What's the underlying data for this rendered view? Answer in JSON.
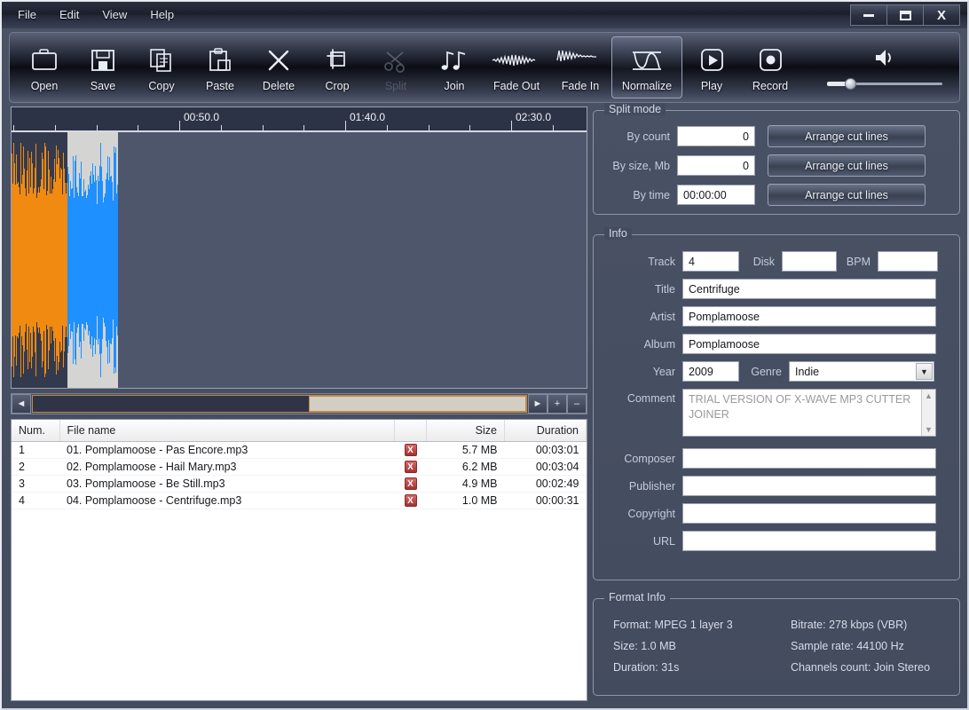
{
  "window": {
    "menus": [
      "File",
      "Edit",
      "View",
      "Help"
    ],
    "controls": {
      "minimize": "–",
      "maximize": "□",
      "close": "X"
    }
  },
  "toolbar": {
    "buttons": [
      {
        "label": "Open",
        "icon": "folder-open-icon",
        "state": "normal"
      },
      {
        "label": "Save",
        "icon": "floppy-disk-icon",
        "state": "normal"
      },
      {
        "label": "Copy",
        "icon": "copy-pages-icon",
        "state": "normal"
      },
      {
        "label": "Paste",
        "icon": "clipboard-icon",
        "state": "normal"
      },
      {
        "label": "Delete",
        "icon": "x-cross-icon",
        "state": "normal"
      },
      {
        "label": "Crop",
        "icon": "crop-icon",
        "state": "normal"
      },
      {
        "label": "Split",
        "icon": "scissors-icon",
        "state": "disabled"
      },
      {
        "label": "Join",
        "icon": "music-notes-icon",
        "state": "normal"
      },
      {
        "label": "Fade Out",
        "icon": "fade-out-wave-icon",
        "state": "normal"
      },
      {
        "label": "Fade In",
        "icon": "fade-in-wave-icon",
        "state": "normal"
      },
      {
        "label": "Normalize",
        "icon": "normalize-wave-icon",
        "state": "selected"
      },
      {
        "label": "Play",
        "icon": "play-icon",
        "state": "normal"
      },
      {
        "label": "Record",
        "icon": "record-icon",
        "state": "normal"
      }
    ],
    "volume": {
      "icon": "speaker-icon",
      "value": 17
    }
  },
  "waveform": {
    "ruler_labels": [
      "00:50.0",
      "01:40.0",
      "02:30.0"
    ],
    "colors": {
      "unselected_wave": "#f08a10",
      "selected_wave": "#1e90ff",
      "selection_bg": "#d4d4d2",
      "track_bg": "#4e566b"
    },
    "scrollbar": {
      "left_arrow": "◄",
      "right_arrow": "►",
      "zoom_in": "+",
      "zoom_out": "–"
    }
  },
  "filelist": {
    "headers": [
      "Num.",
      "File name",
      "",
      "Size",
      "Duration"
    ],
    "rows": [
      {
        "num": "1",
        "name": "01. Pomplamoose - Pas Encore.mp3",
        "delete": "X",
        "size": "5.7 MB",
        "duration": "00:03:01"
      },
      {
        "num": "2",
        "name": "02. Pomplamoose - Hail Mary.mp3",
        "delete": "X",
        "size": "6.2 MB",
        "duration": "00:03:04"
      },
      {
        "num": "3",
        "name": "03. Pomplamoose - Be Still.mp3",
        "delete": "X",
        "size": "4.9 MB",
        "duration": "00:02:49"
      },
      {
        "num": "4",
        "name": "04. Pomplamoose - Centrifuge.mp3",
        "delete": "X",
        "size": "1.0 MB",
        "duration": "00:00:31"
      }
    ]
  },
  "split_mode": {
    "legend": "Split mode",
    "by_count": {
      "label": "By count",
      "value": "0"
    },
    "by_size": {
      "label": "By size, Mb",
      "value": "0"
    },
    "by_time": {
      "label": "By time",
      "value": "00:00:00"
    },
    "button_label": "Arrange cut lines"
  },
  "info": {
    "legend": "Info",
    "track": {
      "label": "Track",
      "value": "4"
    },
    "disk": {
      "label": "Disk",
      "value": ""
    },
    "bpm": {
      "label": "BPM",
      "value": ""
    },
    "title": {
      "label": "Title",
      "value": "Centrifuge"
    },
    "artist": {
      "label": "Artist",
      "value": "Pomplamoose"
    },
    "album": {
      "label": "Album",
      "value": "Pomplamoose"
    },
    "year": {
      "label": "Year",
      "value": "2009"
    },
    "genre": {
      "label": "Genre",
      "value": "Indie"
    },
    "comment": {
      "label": "Comment",
      "value": "TRIAL VERSION OF X-WAVE MP3 CUTTER JOINER"
    },
    "composer": {
      "label": "Composer",
      "value": ""
    },
    "publisher": {
      "label": "Publisher",
      "value": ""
    },
    "copyright": {
      "label": "Copyright",
      "value": ""
    },
    "url": {
      "label": "URL",
      "value": ""
    }
  },
  "format_info": {
    "legend": "Format Info",
    "format": "Format: MPEG 1 layer 3",
    "bitrate": "Bitrate: 278 kbps (VBR)",
    "size": "Size: 1.0 MB",
    "samplerate": "Sample rate: 44100 Hz",
    "duration": "Duration: 31s",
    "channels": "Channels count: Join Stereo"
  }
}
